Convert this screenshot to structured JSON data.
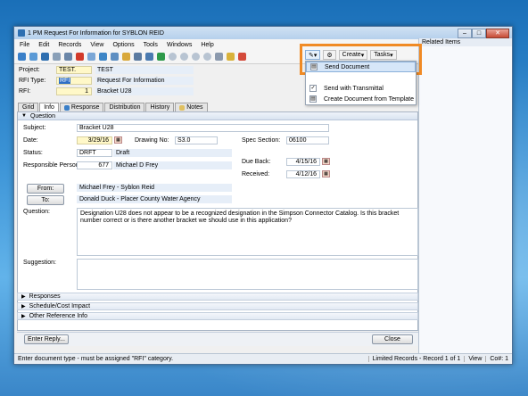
{
  "window": {
    "title": "1 PM Request For Information for SYBLON REID",
    "min": "–",
    "max": "□",
    "close": "✕"
  },
  "menu": [
    "File",
    "Edit",
    "Records",
    "View",
    "Options",
    "Tools",
    "Windows",
    "Help"
  ],
  "toolbar_highlight": {
    "create_label": "Create",
    "tasks_label": "Tasks"
  },
  "dropdown": {
    "items": [
      "Send Document",
      "Send with Transmittal",
      "Create Document from Template"
    ]
  },
  "related_items_label": "Related Items",
  "header": {
    "project_label": "Project:",
    "project_code": "TEST.",
    "project_name": "TEST",
    "rfi_type_label": "RFI Type:",
    "rfi_type_code": "RFI",
    "rfi_type_name": "Request For Information",
    "rfi_label": "RFI:",
    "rfi_number": "1",
    "rfi_name": "Bracket U28"
  },
  "tabs": [
    "Grid",
    "Info",
    "Response",
    "Distribution",
    "History",
    "Notes"
  ],
  "section_question": "Question",
  "form": {
    "subject_label": "Subject:",
    "subject": "Bracket U28",
    "date_label": "Date:",
    "date": "3/29/16",
    "drawing_label": "Drawing No:",
    "drawing": "S3.0",
    "spec_label": "Spec Section:",
    "spec": "06100",
    "status_label": "Status:",
    "status_code": "DRFT",
    "status_name": "Draft",
    "responsible_label": "Responsible Person:",
    "responsible_id": "677",
    "responsible_name": "Michael D Frey",
    "due_back_label": "Due Back:",
    "due_back": "4/15/16",
    "received_label": "Received:",
    "received": "4/12/16",
    "from_button": "From:",
    "from_value": "Michael Frey - Syblon Reid",
    "to_button": "To:",
    "to_value": "Donald Duck - Placer County Water Agency",
    "question_label": "Question:",
    "question_text": "Designation U28 does not appear to be a recognized designation in the Simpson Connector Catalog.  Is this bracket number correct or is there another bracket we should use in this application?",
    "suggestion_label": "Suggestion:"
  },
  "collapsed_sections": [
    "Responses",
    "Schedule/Cost Impact",
    "Other Reference Info"
  ],
  "buttons": {
    "enter_reply": "Enter Reply...",
    "close": "Close"
  },
  "statusbar": {
    "message": "Enter document type - must be assigned \"RFI\" category.",
    "limited": "Limited Records - Record 1 of 1",
    "view": "View",
    "co": "Co#: 1"
  }
}
